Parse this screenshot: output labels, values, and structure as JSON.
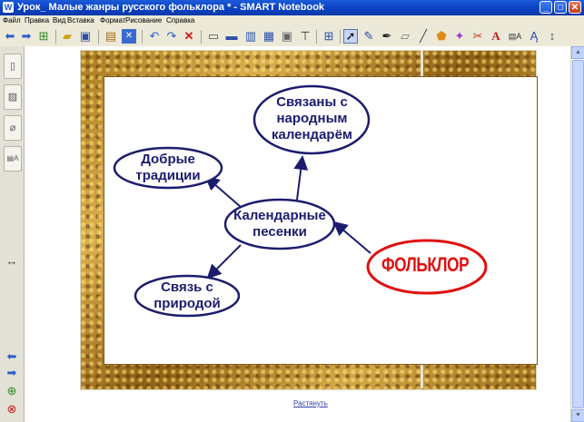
{
  "window": {
    "title": "Урок_ Малые жанры русского фольклора * - SMART Notebook",
    "app_icon": "smart-notebook-icon",
    "controls": {
      "minimize": "_",
      "maximize": "□",
      "close": "✕"
    }
  },
  "menu": [
    "Файл",
    "Правка",
    "Вид",
    "Вставка",
    "Формат",
    "Рисование",
    "Справка"
  ],
  "toolbar_icons": [
    "back-arrow-icon",
    "forward-arrow-icon",
    "add-page-icon",
    "open-folder-icon",
    "save-icon",
    "paste-icon",
    "delete-x-icon",
    "undo-icon",
    "redo-icon",
    "delete-icon",
    "screen-shade-icon",
    "full-screen-icon",
    "dual-page-icon",
    "capture-icon",
    "table-icon",
    "select-arrow-icon",
    "pen-icon",
    "creative-pen-icon",
    "eraser-icon",
    "line-icon",
    "shape-icon",
    "magic-pen-icon",
    "fill-icon",
    "text-icon",
    "properties-icon",
    "move-toolbar-icon"
  ],
  "sidebar": {
    "tabs": [
      "page-sorter-icon",
      "gallery-icon",
      "attachments-icon",
      "properties-icon"
    ],
    "resize": "↔",
    "nav": [
      "back-arrow-icon",
      "forward-arrow-icon",
      "add-page-icon",
      "delete-page-icon"
    ]
  },
  "diagram": {
    "center": "Календарные\nпесенки",
    "top_right": "Связаны с\nнародным\nкалендарём",
    "top_left": "Добрые\nтрадиции",
    "bottom_left": "Связь с\nприродой",
    "folklore": "ФОЛЬКЛОР"
  },
  "footer_link": "Растянуть",
  "colors": {
    "accent": "#1C1C6E",
    "folklore": "#E01010",
    "titlebar": "#0A3FC0"
  }
}
